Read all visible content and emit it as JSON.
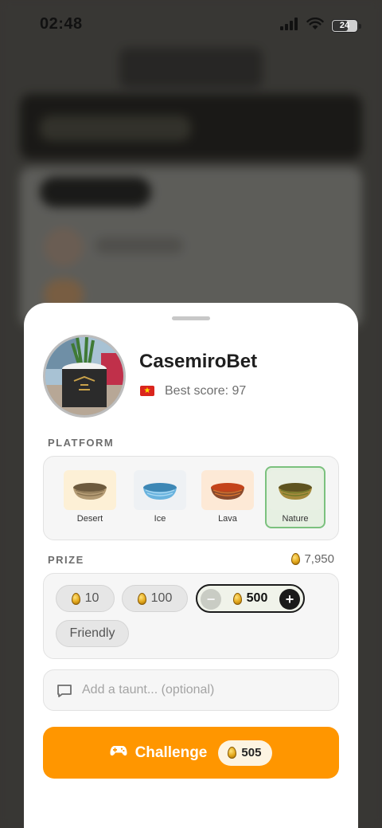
{
  "status_bar": {
    "time": "02:48",
    "battery": "24"
  },
  "profile": {
    "username": "CasemiroBet",
    "flag": "★",
    "best_score": "Best score: 97"
  },
  "platform": {
    "label": "PLATFORM",
    "options": [
      {
        "label": "Desert",
        "selected": false
      },
      {
        "label": "Ice",
        "selected": false
      },
      {
        "label": "Lava",
        "selected": false
      },
      {
        "label": "Nature",
        "selected": true
      }
    ]
  },
  "prize": {
    "label": "PRIZE",
    "balance": "7,950",
    "options": [
      "10",
      "100",
      "500",
      "Friendly"
    ],
    "selected": "500"
  },
  "taunt": {
    "placeholder": "Add a taunt... (optional)"
  },
  "challenge": {
    "label": "Challenge",
    "cost": "505"
  },
  "colors": {
    "accent": "#ff9600",
    "selected_border": "#7bc17e",
    "sheet": "#ffffff"
  }
}
